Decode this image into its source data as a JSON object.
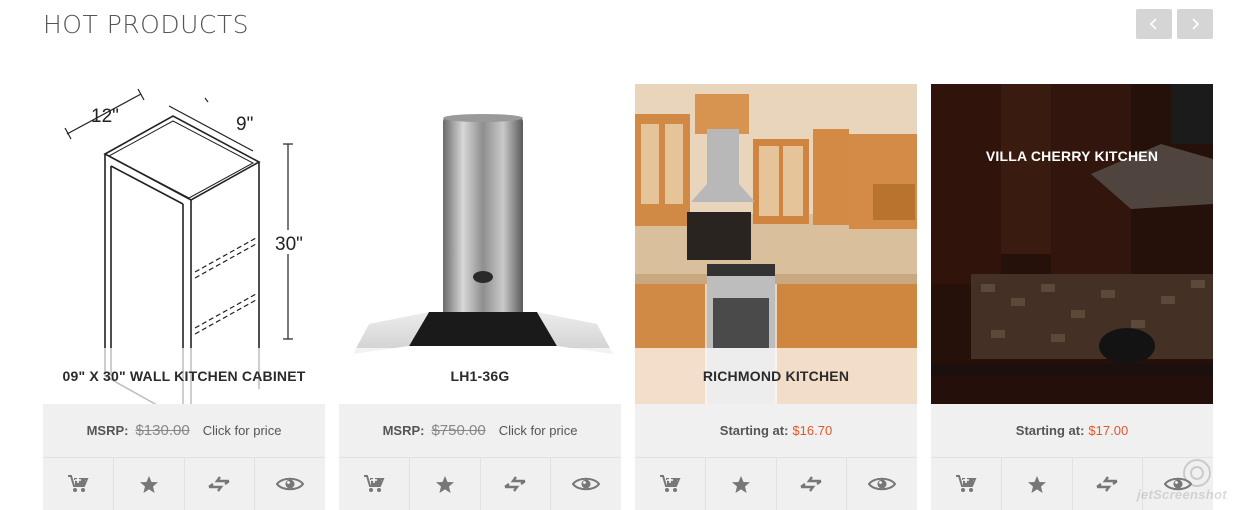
{
  "section": {
    "title": "HOT PRODUCTS"
  },
  "carousel": {
    "prev_icon": "chevron-left-icon",
    "next_icon": "chevron-right-icon"
  },
  "products": [
    {
      "name": "09\" X 30\" WALL KITCHEN CABINET",
      "msrp_label": "MSRP:",
      "msrp_old": "$130.00",
      "cta": "Click for price",
      "dims": {
        "depth": "12\"",
        "width": "9\"",
        "height": "30\""
      }
    },
    {
      "name": "LH1-36G",
      "msrp_label": "MSRP:",
      "msrp_old": "$750.00",
      "cta": "Click for price"
    },
    {
      "name": "RICHMOND KITCHEN",
      "start_label": "Starting at:",
      "price": "$16.70"
    },
    {
      "name": "VILLA CHERRY KITCHEN",
      "start_label": "Starting at:",
      "price": "$17.00"
    }
  ],
  "actions": [
    "add-to-cart-icon",
    "wishlist-star-icon",
    "compare-icon",
    "quick-view-eye-icon"
  ],
  "colors": {
    "price": "#e2562a",
    "panel": "#f0f0f0",
    "nav_button": "#d5d5d5"
  },
  "watermark": {
    "text": "jetScreenshot"
  }
}
